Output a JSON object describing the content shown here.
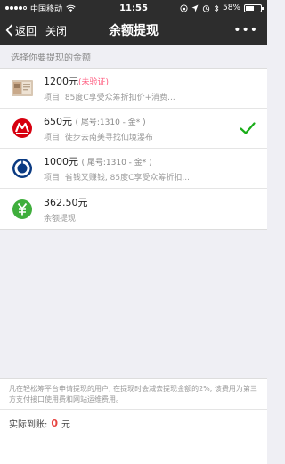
{
  "status_bar": {
    "carrier": "中国移动",
    "time": "11:55",
    "battery": "58%",
    "battery_level": 0.58
  },
  "nav": {
    "back_label": "返回",
    "close_label": "关闭",
    "title": "余额提现",
    "more_label": "•••"
  },
  "section_label": "选择你要提现的金额",
  "items": [
    {
      "amount": "1200元",
      "status": "(未验证)",
      "detail": "项目: 85度C享受众筹折扣价+消费...",
      "logo": "book-thumbnail-icon"
    },
    {
      "amount": "650元",
      "account": "( 尾号:1310 - 金* )",
      "detail": "项目: 徒步去南美寻找仙境瀑布",
      "logo": "cmb-bank-icon",
      "selected": true
    },
    {
      "amount": "1000元",
      "account": "( 尾号:1310 - 金* )",
      "detail": "项目: 省钱又赚钱, 85度C享受众筹折扣...",
      "logo": "ccb-bank-icon"
    },
    {
      "amount": "362.50元",
      "detail": "余额提现",
      "logo": "yuan-balance-icon"
    }
  ],
  "footer": {
    "notice": "凡在轻松筹平台申请提现的用户, 在提现时会减去提现金额的2%, 该费用为第三方支付接口使用费和网站运维费用。",
    "total_label": "实际到账:",
    "total_value": "0",
    "total_unit": "元"
  },
  "colors": {
    "nav_bg": "#2d2d2d",
    "check": "#1aad19",
    "warn": "#ff5a7e",
    "total_value": "#e64340"
  }
}
